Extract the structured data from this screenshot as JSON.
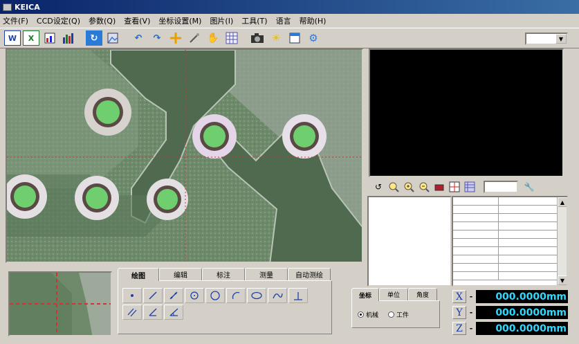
{
  "window": {
    "title": "KEICA"
  },
  "menu": {
    "items": [
      "文件(F)",
      "CCD设定(Q)",
      "参数(Q)",
      "查看(V)",
      "坐标设置(M)",
      "图片(I)",
      "工具(T)",
      "语言",
      "帮助(H)"
    ]
  },
  "toolbar": {
    "icons": [
      "word-icon",
      "excel-icon",
      "report-icon",
      "chart-icon",
      "rotate-icon",
      "image-icon",
      "undo-icon",
      "redo-icon",
      "crosshair-icon",
      "probe-icon",
      "hand-icon",
      "grid-icon",
      "camera-icon",
      "light-icon",
      "window-icon",
      "settings-icon"
    ],
    "dropdown_value": ""
  },
  "zoom_toolbar": {
    "zoom_value": ""
  },
  "draw_tabs": {
    "tabs": [
      "绘图",
      "编辑",
      "标注",
      "测量",
      "自动测绘"
    ],
    "active": "绘图"
  },
  "coord_tabs": {
    "tabs": [
      "坐标",
      "单位",
      "角度"
    ],
    "active": "坐标",
    "radio_machine": "机械",
    "radio_workpiece": "工件",
    "selected": "机械"
  },
  "readout": {
    "x_label": "X",
    "x_value": "000.0000mm",
    "y_label": "Y",
    "y_value": "000.0000mm",
    "z_label": "Z",
    "z_value": "000.0000mm"
  },
  "colors": {
    "title_bar": "#0a246a",
    "readout_text": "#2fd8ff",
    "axis_label": "#1a3fa8",
    "board_green": "#4f6a4f",
    "pad_fill": "#6fcf6f",
    "crosshair": "#d83030"
  }
}
